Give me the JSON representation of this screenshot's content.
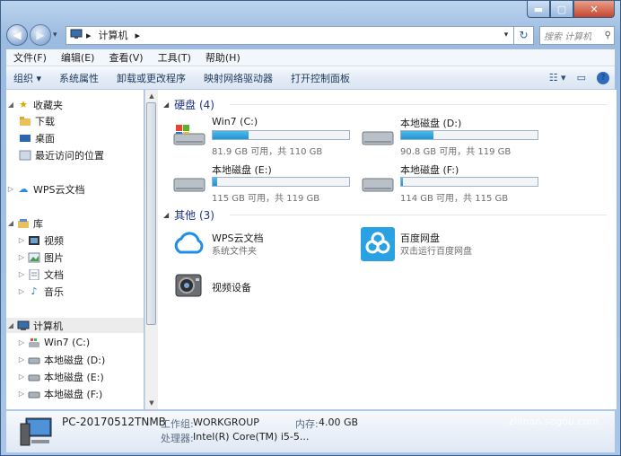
{
  "window": {
    "min_label": "▬",
    "max_label": "▢",
    "close_label": "✕"
  },
  "address": {
    "back_label": "◀",
    "forward_label": "▶",
    "crumb_sep": "▸",
    "crumb": "计算机",
    "search_placeholder": "搜索 计算机"
  },
  "menu": [
    "文件(F)",
    "编辑(E)",
    "查看(V)",
    "工具(T)",
    "帮助(H)"
  ],
  "toolbar": {
    "organize": "组织 ▾",
    "items": [
      "系统属性",
      "卸载或更改程序",
      "映射网络驱动器",
      "打开控制面板"
    ]
  },
  "nav": {
    "favorites": "收藏夹",
    "downloads": "下载",
    "desktop": "桌面",
    "recent": "最近访问的位置",
    "wps": "WPS云文档",
    "libraries": "库",
    "videos": "视频",
    "pictures": "图片",
    "documents": "文档",
    "music": "音乐",
    "computer": "计算机",
    "drive_c": "Win7 (C:)",
    "drive_d": "本地磁盘 (D:)",
    "drive_e": "本地磁盘 (E:)",
    "drive_f": "本地磁盘 (F:)"
  },
  "groups": {
    "hdd": "硬盘 (4)",
    "other": "其他 (3)"
  },
  "drives": [
    {
      "name": "Win7 (C:)",
      "free_text": "81.9 GB 可用，共 110 GB",
      "used_fraction": 0.26,
      "system": true
    },
    {
      "name": "本地磁盘 (D:)",
      "free_text": "90.8 GB 可用，共 119 GB",
      "used_fraction": 0.24,
      "system": false
    },
    {
      "name": "本地磁盘 (E:)",
      "free_text": "115 GB 可用，共 119 GB",
      "used_fraction": 0.034,
      "system": false
    },
    {
      "name": "本地磁盘 (F:)",
      "free_text": "114 GB 可用，共 115 GB",
      "used_fraction": 0.009,
      "system": false
    }
  ],
  "others": [
    {
      "name": "WPS云文档",
      "sub": "系统文件夹"
    },
    {
      "name": "百度网盘",
      "sub": "双击运行百度网盘"
    },
    {
      "name": "视频设备",
      "sub": ""
    }
  ],
  "details": {
    "pc_name": "PC-20170512TNMB",
    "workgroup_label": "工作组:",
    "workgroup": "WORKGROUP",
    "memory_label": "内存:",
    "memory": "4.00 GB",
    "cpu_label": "处理器:",
    "cpu": "Intel(R) Core(TM) i5-5..."
  },
  "watermark": {
    "text": "搜狗指南",
    "url": "zhinan.sogou.com"
  },
  "colors": {
    "accent": "#1e3287",
    "bar_fill": "#2194d6",
    "close": "#c6452c"
  }
}
